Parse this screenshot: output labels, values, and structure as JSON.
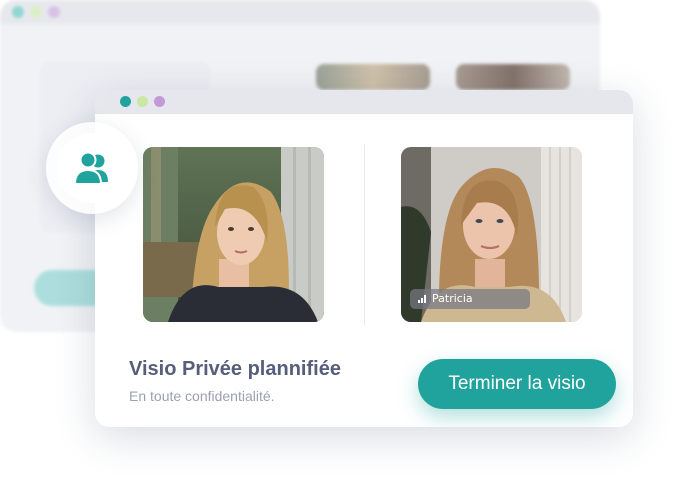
{
  "colors": {
    "accent": "#20a39c",
    "dot_teal": "#20a39c",
    "dot_green": "#c9e8a2",
    "dot_purple": "#c39ad9",
    "title": "#575e7a",
    "subtitle": "#9aa0b2"
  },
  "icons": {
    "badge": "users-icon",
    "signal": "signal-bars-icon"
  },
  "call": {
    "remote_participant": "Patricia"
  },
  "card": {
    "title": "Visio Privée plannifiée",
    "subtitle": "En toute confidentialité.",
    "end_button_label": "Terminer la visio"
  }
}
